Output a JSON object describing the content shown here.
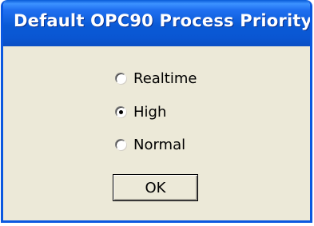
{
  "window": {
    "title": "Default OPC90 Process Priority"
  },
  "priority_options": [
    {
      "label": "Realtime",
      "selected": false
    },
    {
      "label": "High",
      "selected": true
    },
    {
      "label": "Normal",
      "selected": false
    }
  ],
  "ok_button": {
    "label": "OK"
  },
  "colors": {
    "title_bar": "#0a5ad6",
    "window_face": "#ece9d8",
    "frame": "#0a58e0"
  }
}
